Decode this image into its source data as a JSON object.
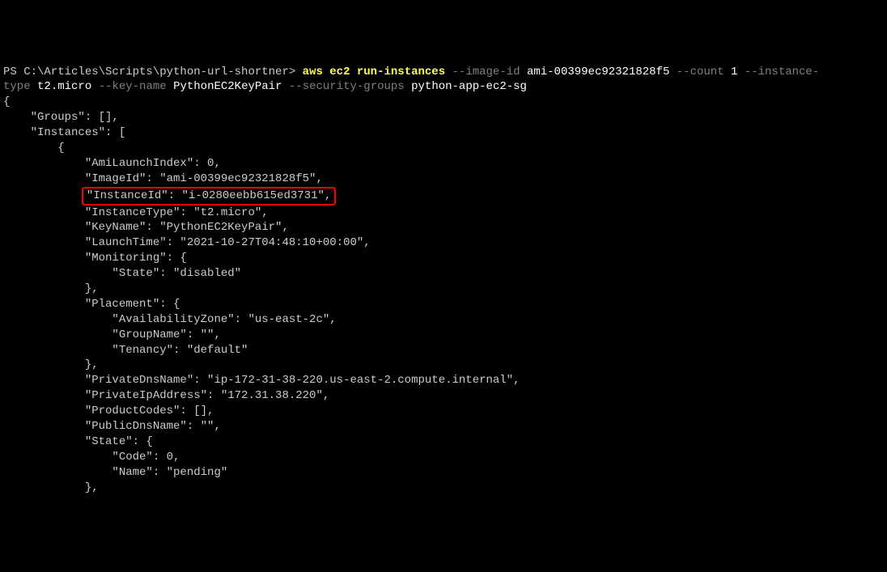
{
  "prompt": {
    "prefix": "PS C:\\Articles\\Scripts\\python-url-shortner> ",
    "cmd": "aws ec2 run-instances",
    "flag1": " --image-id ",
    "val1": "ami-00399ec92321828f5",
    "flag2": " --count ",
    "val2": "1",
    "flag3": " --instance-",
    "line2a": "type ",
    "val3": "t2.micro",
    "flag4": " --key-name ",
    "val4": "PythonEC2KeyPair",
    "flag5": " --security-groups ",
    "val5": "python-app-ec2-sg"
  },
  "out": {
    "l1": "{",
    "l2": "    \"Groups\": [],",
    "l3": "    \"Instances\": [",
    "l4": "        {",
    "l5": "            \"AmiLaunchIndex\": 0,",
    "l6": "            \"ImageId\": \"ami-00399ec92321828f5\",",
    "l7pad": "            ",
    "l7": "\"InstanceId\": \"i-0280eebb615ed3731\",",
    "l8": "            \"InstanceType\": \"t2.micro\",",
    "l9": "            \"KeyName\": \"PythonEC2KeyPair\",",
    "l10": "            \"LaunchTime\": \"2021-10-27T04:48:10+00:00\",",
    "l11": "            \"Monitoring\": {",
    "l12": "                \"State\": \"disabled\"",
    "l13": "            },",
    "l14": "            \"Placement\": {",
    "l15": "                \"AvailabilityZone\": \"us-east-2c\",",
    "l16": "                \"GroupName\": \"\",",
    "l17": "                \"Tenancy\": \"default\"",
    "l18": "            },",
    "l19": "            \"PrivateDnsName\": \"ip-172-31-38-220.us-east-2.compute.internal\",",
    "l20": "            \"PrivateIpAddress\": \"172.31.38.220\",",
    "l21": "            \"ProductCodes\": [],",
    "l22": "            \"PublicDnsName\": \"\",",
    "l23": "            \"State\": {",
    "l24": "                \"Code\": 0,",
    "l25": "                \"Name\": \"pending\"",
    "l26": "            },"
  }
}
